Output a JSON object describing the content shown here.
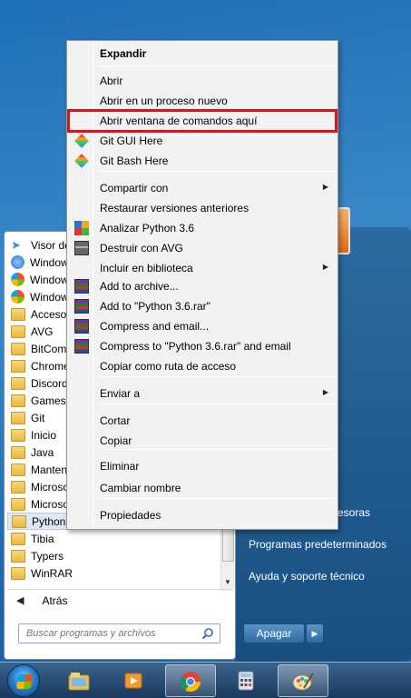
{
  "start_menu": {
    "programs": [
      {
        "label": "Visor de",
        "icon": "paper-plane-icon"
      },
      {
        "label": "Window",
        "icon": "app-icon"
      },
      {
        "label": "Window",
        "icon": "windows-icon"
      },
      {
        "label": "Window",
        "icon": "windows-icon"
      },
      {
        "label": "Accesor",
        "icon": "folder-icon"
      },
      {
        "label": "AVG",
        "icon": "folder-icon"
      },
      {
        "label": "BitCom",
        "icon": "folder-icon"
      },
      {
        "label": "Chrome",
        "icon": "folder-icon"
      },
      {
        "label": "Discord",
        "icon": "folder-icon"
      },
      {
        "label": "Games",
        "icon": "folder-icon"
      },
      {
        "label": "Git",
        "icon": "folder-icon"
      },
      {
        "label": "Inicio",
        "icon": "folder-icon"
      },
      {
        "label": "Java",
        "icon": "folder-icon"
      },
      {
        "label": "Manten",
        "icon": "folder-icon"
      },
      {
        "label": "Microso",
        "icon": "folder-icon"
      },
      {
        "label": "Microso",
        "icon": "folder-icon"
      },
      {
        "label": "Python",
        "icon": "folder-icon"
      },
      {
        "label": "Tibia",
        "icon": "folder-icon"
      },
      {
        "label": "Typers",
        "icon": "folder-icon"
      },
      {
        "label": "WinRAR",
        "icon": "folder-icon"
      }
    ],
    "selected_program_index": 16,
    "back_label": "Atrás",
    "search_placeholder": "Buscar programas y archivos",
    "right_links": {
      "devices": "esoras",
      "default_programs": "Programas predeterminados",
      "help": "Ayuda y soporte técnico"
    },
    "shutdown_label": "Apagar"
  },
  "context_menu": {
    "items": [
      {
        "label": "Expandir",
        "bold": true
      },
      {
        "label": "Abrir"
      },
      {
        "label": "Abrir en un proceso nuevo"
      },
      {
        "label": "Abrir ventana de comandos aquí",
        "highlighted": true
      },
      {
        "label": "Git GUI Here",
        "icon": "git-gui-icon"
      },
      {
        "label": "Git Bash Here",
        "icon": "git-bash-icon"
      },
      {
        "label": "Compartir con",
        "submenu": true
      },
      {
        "label": "Restaurar versiones anteriores"
      },
      {
        "label": "Analizar Python 3.6",
        "icon": "avg-scan-icon"
      },
      {
        "label": "Destruir con AVG",
        "icon": "shredder-icon"
      },
      {
        "label": "Incluir en biblioteca",
        "submenu": true
      },
      {
        "label": "Add to archive...",
        "icon": "winrar-icon"
      },
      {
        "label": "Add to \"Python 3.6.rar\"",
        "icon": "winrar-icon"
      },
      {
        "label": "Compress and email...",
        "icon": "winrar-icon"
      },
      {
        "label": "Compress to \"Python 3.6.rar\" and email",
        "icon": "winrar-icon"
      },
      {
        "label": "Copiar como ruta de acceso"
      },
      {
        "label": "Enviar a",
        "submenu": true
      },
      {
        "label": "Cortar"
      },
      {
        "label": "Copiar"
      },
      {
        "label": "Eliminar"
      },
      {
        "label": "Cambiar nombre"
      },
      {
        "label": "Propiedades"
      }
    ]
  },
  "taskbar": {
    "apps": [
      "file-explorer-icon",
      "media-player-icon",
      "chrome-icon",
      "calculator-icon",
      "paint-icon"
    ],
    "active_app": "chrome-icon"
  },
  "colors": {
    "highlight_border": "#e0101a",
    "menu_background": "#f2f2f2",
    "start_right_panel": "#1f5a8f"
  }
}
